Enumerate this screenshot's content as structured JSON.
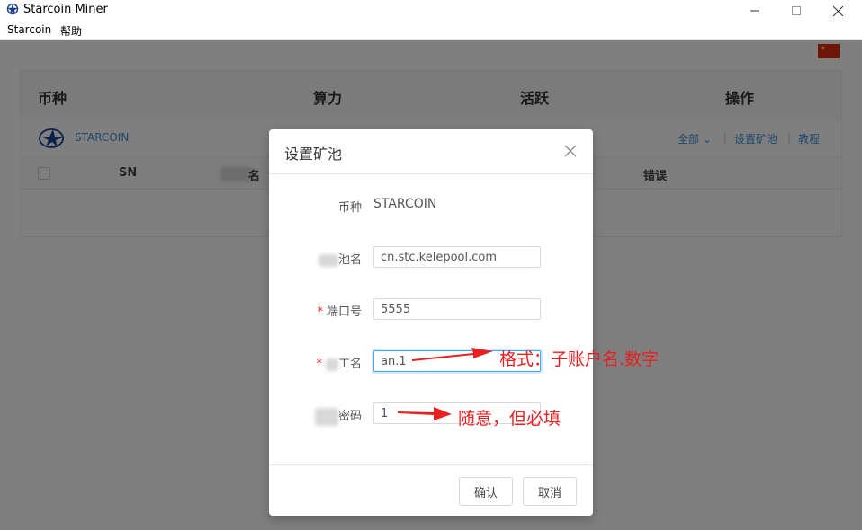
{
  "window": {
    "title": "Starcoin Miner",
    "minimize_glyph": "—",
    "maximize_glyph": "☐",
    "close_glyph": "✕"
  },
  "menu": {
    "items": [
      {
        "label": "Starcoin"
      },
      {
        "label": "帮助"
      }
    ]
  },
  "language_flag": {
    "icon": "china-flag-icon",
    "color": "#de2910"
  },
  "table": {
    "headers": {
      "coin": "币种",
      "hashrate": "算力",
      "active": "活跃",
      "actions": "操作"
    },
    "coin_row": {
      "name": "STARCOIN",
      "actions": {
        "all": "全部",
        "set_pool": "设置矿池",
        "tutorial": "教程"
      }
    },
    "sub_headers": {
      "sn": "SN",
      "name_suffix": "名",
      "error": "错误"
    }
  },
  "modal": {
    "title": "设置矿池",
    "fields": {
      "coin": {
        "label": "币种",
        "value": "STARCOIN"
      },
      "pool": {
        "label_suffix": "池名",
        "value": "cn.stc.kelepool.com"
      },
      "port": {
        "label": "端口号",
        "value": "5555",
        "required": "*"
      },
      "worker": {
        "label_suffix": "工名",
        "value": "an.1",
        "required": "*"
      },
      "password": {
        "label_suffix": "密码",
        "value": "1"
      }
    },
    "buttons": {
      "ok": "确认",
      "cancel": "取消"
    }
  },
  "annotations": {
    "worker_note": "格式：子账户名.数字",
    "password_note": "随意，但必填",
    "color": "#e9201f"
  }
}
